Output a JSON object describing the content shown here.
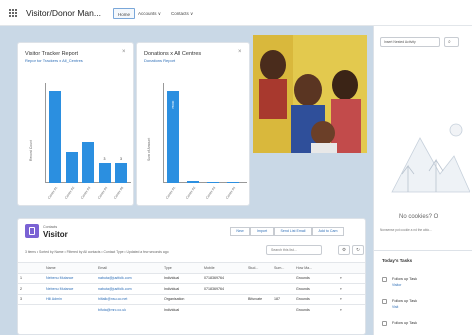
{
  "app": {
    "title": "Visitor/Donor Man...",
    "nav": [
      {
        "label": "Home"
      },
      {
        "label": "Accounts ∨"
      },
      {
        "label": "Contacts ∨"
      }
    ]
  },
  "tiles": [
    {
      "title": "Visitor Tracker Report",
      "subtitle": "Repor tor Trackers x All_Centres",
      "link": "View Report (Visitor Tracker Report)",
      "x_footer": "All_Centre",
      "chart_data": {
        "type": "bar",
        "categories": [
          "Centre 01",
          "Centre 02",
          "Centre 03",
          "Centre 04",
          "Centre 05"
        ],
        "values": [
          9,
          3,
          4,
          2,
          2
        ],
        "ylabel": "Record Count",
        "value_labels": [
          "",
          "",
          "",
          "3",
          "3"
        ]
      }
    },
    {
      "title": "Donations x All Centres",
      "subtitle": "Donations Report",
      "link": "View Report (Donations x All Centres)",
      "x_footer": "Centre to Donate",
      "chart_data": {
        "type": "bar",
        "categories": [
          "Centre 01",
          "Centre 02",
          "Centre 03",
          "Centre 04"
        ],
        "values": [
          78000,
          2000,
          1000,
          1000
        ],
        "ylabel": "Sum of Amount",
        "inner_label": "78000"
      }
    }
  ],
  "activity": {
    "filter": "Insert Nested Activity",
    "empty_title": "No cookies? O",
    "empty_sub": "Nonsense pot cookie a nd the ablo..."
  },
  "tasks": {
    "title": "Today's Tasks",
    "items": [
      {
        "name": "Follow up Task",
        "who": "Visitor"
      },
      {
        "name": "Follow up Task",
        "who": "Visit"
      },
      {
        "name": "Follow up Task",
        "who": ""
      }
    ]
  },
  "listview": {
    "object": "Contacts",
    "name": "Visitor",
    "buttons": [
      "New",
      "Import",
      "Send List Email",
      "Add to Cam"
    ],
    "meta": "3 items • Sorted by Name • Filtered by All contacts • Contact Type • Updated a few seconds ago",
    "search_placeholder": "Search this list...",
    "columns": [
      "",
      "Name",
      "Email",
      "Type",
      "Mobile",
      "Stud...",
      "Sum...",
      "How Ma...",
      ""
    ],
    "rows": [
      [
        "1",
        "Nebenu Mutance",
        "nabuta@justfolk.com",
        "Individual",
        "0718369764",
        "",
        "",
        "Grounds",
        "▾"
      ],
      [
        "2",
        "Nebenu Mutance",
        "nabuta@justfolk.com",
        "Individual",
        "0718369764",
        "",
        "",
        "Grounds",
        "▾"
      ],
      [
        "3",
        "Hili Admin",
        "hiltalk@nsu.co.net",
        "Organisation",
        "",
        "Bifurcate",
        "187",
        "Grounds",
        "▾"
      ],
      [
        "",
        "",
        "bifuta@mrc.co.uk",
        "Individual",
        "",
        "",
        "",
        "Grounds",
        "▾"
      ]
    ]
  },
  "colors": {
    "bar": "#2b8fe0",
    "link": "#2f6fb7",
    "contact_icon": "#7a62d4",
    "background": "#c9d8e6"
  }
}
